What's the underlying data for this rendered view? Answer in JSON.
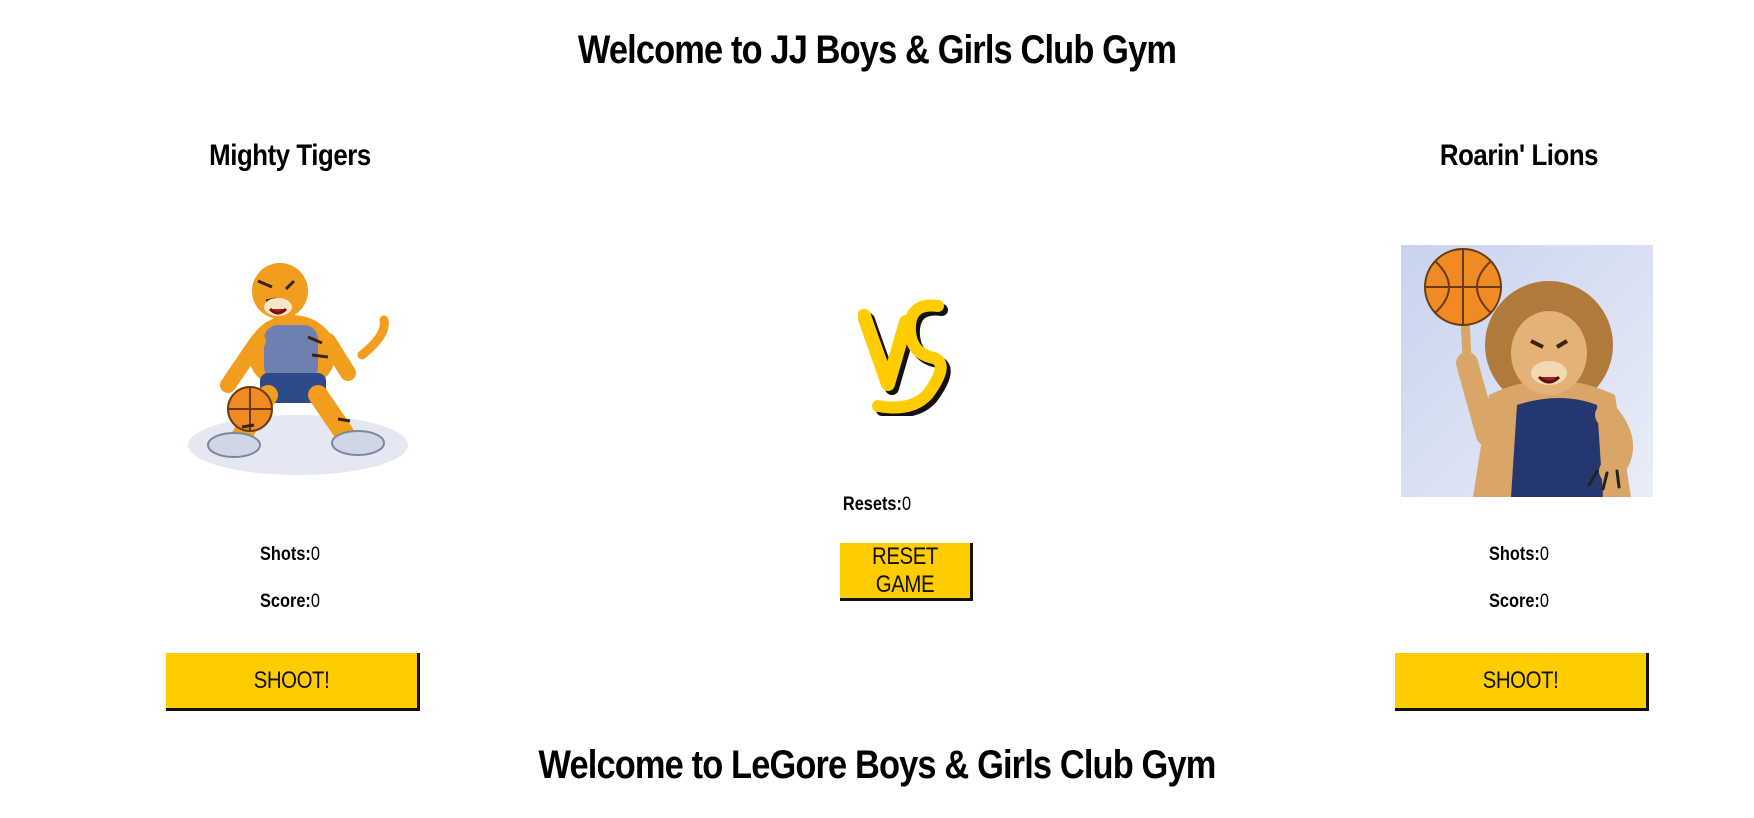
{
  "header": {
    "title": "Welcome to JJ Boys & Girls Club Gym"
  },
  "footer": {
    "title": "Welcome to LeGore Boys & Girls Club Gym"
  },
  "teams": [
    {
      "name": "Mighty Tigers",
      "mascot_icon": "tiger-basketball-mascot",
      "shots_label": "Shots:",
      "shots_value": "0",
      "score_label": "Score:",
      "score_value": "0",
      "shoot_label": "SHOOT!"
    },
    {
      "name": "Roarin' Lions",
      "mascot_icon": "lion-basketball-mascot",
      "shots_label": "Shots:",
      "shots_value": "0",
      "score_label": "Score:",
      "score_value": "0",
      "shoot_label": "SHOOT!"
    }
  ],
  "center": {
    "vs_icon": "vs-logo",
    "resets_label": "Resets:",
    "resets_value": "0",
    "reset_label": "RESET GAME"
  },
  "colors": {
    "accent": "#ffcc00",
    "text": "#000000",
    "background": "#ffffff"
  }
}
